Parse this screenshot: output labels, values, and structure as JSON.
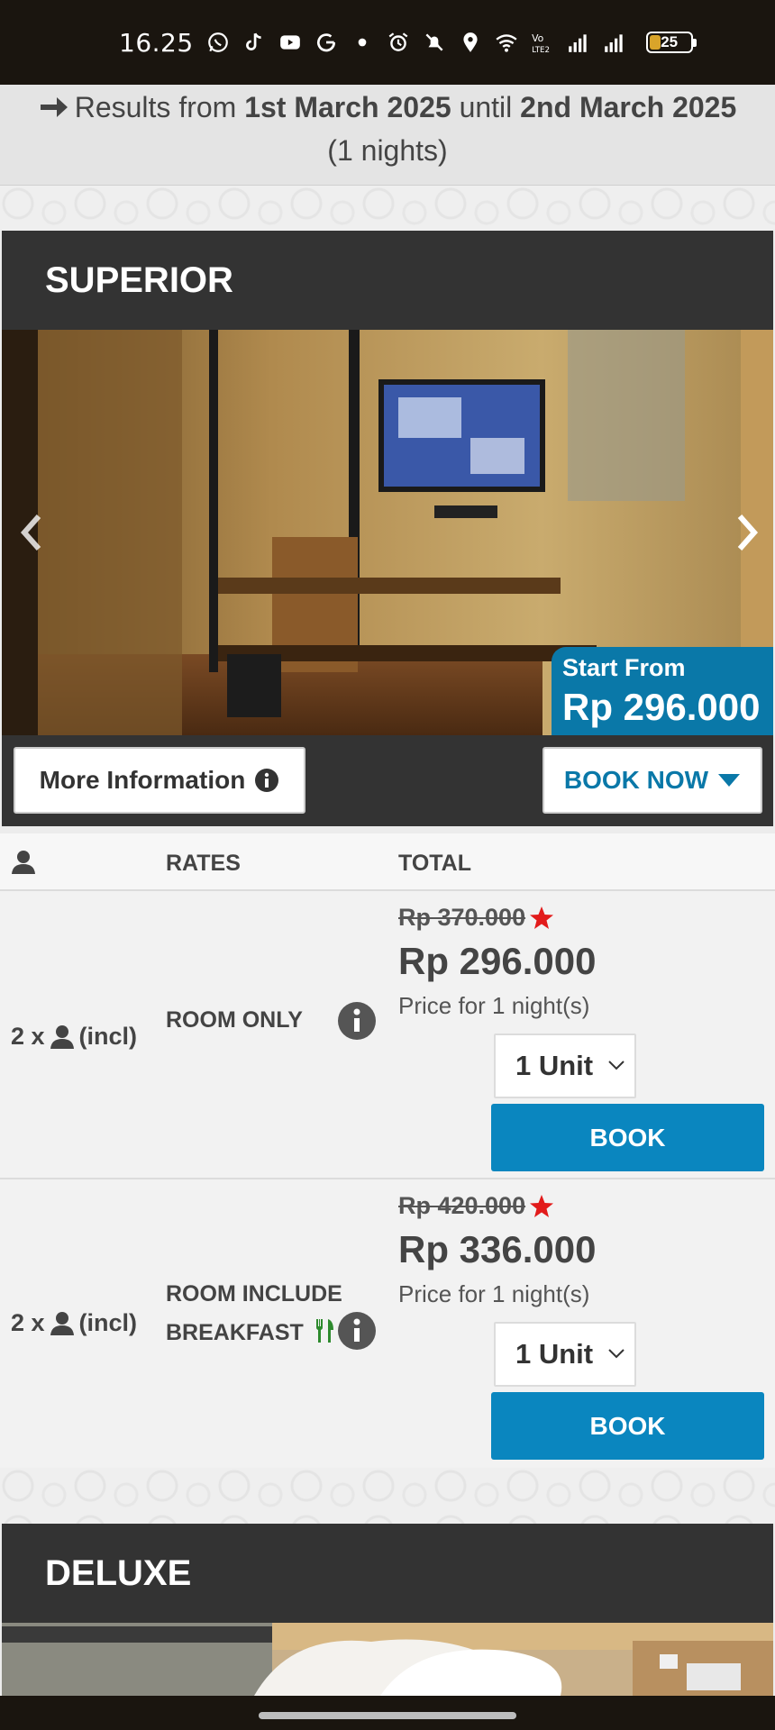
{
  "status_bar": {
    "time": "16.25",
    "battery": "25",
    "icons": [
      "whatsapp-icon",
      "tiktok-icon",
      "youtube-icon",
      "google-icon",
      "dot-icon",
      "alarm-icon",
      "mute-icon",
      "location-icon",
      "wifi-icon",
      "volte-icon",
      "signal-icon",
      "signal-icon-2"
    ]
  },
  "results": {
    "prefix": "Results from",
    "start_date": "1st March 2025",
    "until": "until",
    "end_date": "2nd March 2025",
    "nights": "(1 nights)"
  },
  "rooms": [
    {
      "name": "SUPERIOR",
      "start_from_label": "Start From",
      "start_from_price": "Rp 296.000",
      "more_info_label": "More Information",
      "book_now_label": "BOOK NOW"
    },
    {
      "name": "DELUXE"
    }
  ],
  "rates_table": {
    "headers": {
      "rates": "RATES",
      "total": "TOTAL"
    },
    "rows": [
      {
        "occupancy_prefix": "2 x",
        "occupancy_suffix": "(incl)",
        "rate_line1": "ROOM ONLY",
        "rate_line2": "",
        "old_price": "Rp 370.000",
        "new_price": "Rp 296.000",
        "price_note": "Price for 1 night(s)",
        "unit": "1 Unit",
        "book_label": "BOOK"
      },
      {
        "occupancy_prefix": "2 x",
        "occupancy_suffix": "(incl)",
        "rate_line1": "ROOM INCLUDE",
        "rate_line2": "BREAKFAST",
        "old_price": "Rp 420.000",
        "new_price": "Rp 336.000",
        "price_note": "Price for 1 night(s)",
        "unit": "1 Unit",
        "book_label": "BOOK"
      }
    ]
  },
  "colors": {
    "accent": "#0a86bf",
    "header_dark": "#333333",
    "star": "#e21b1b",
    "breakfast_icon": "#2e8b2e"
  }
}
